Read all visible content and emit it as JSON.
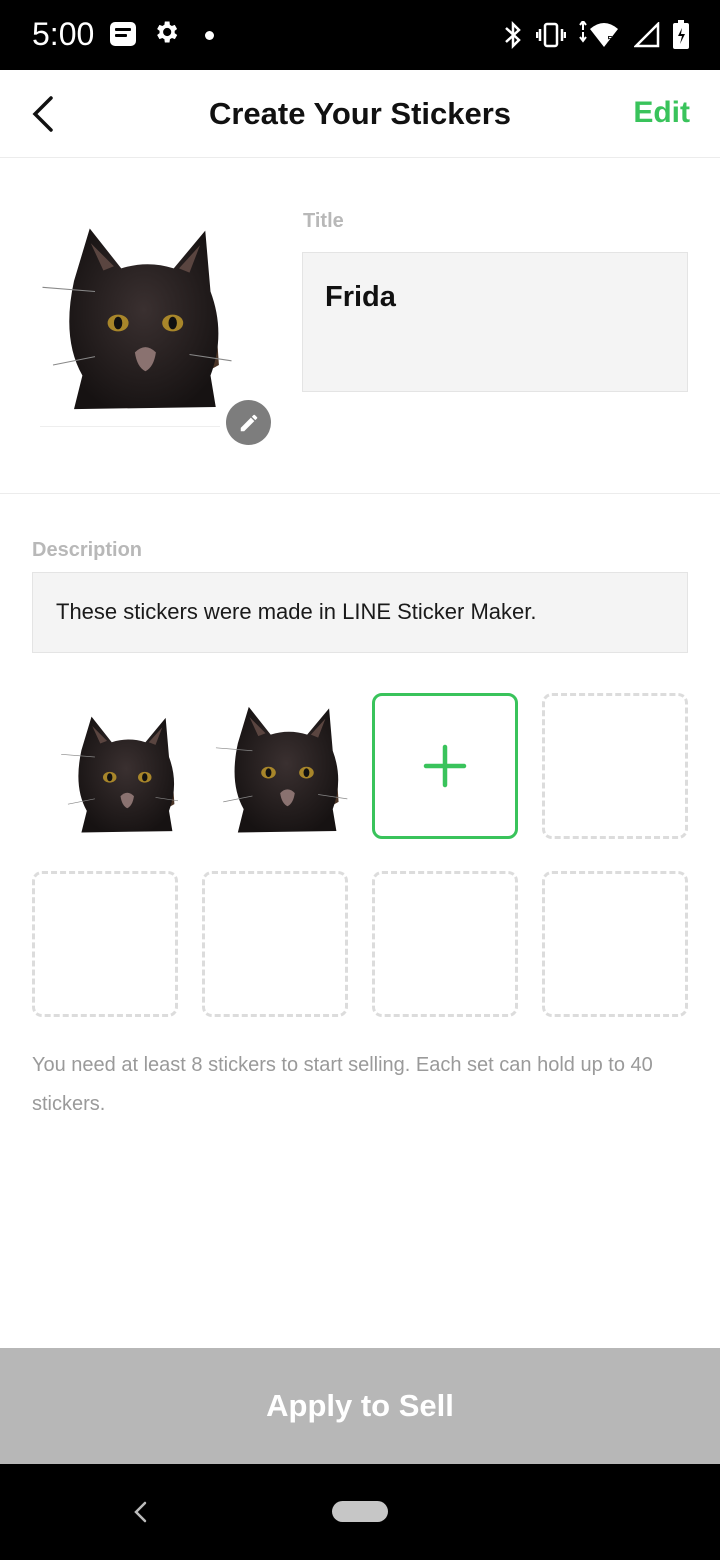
{
  "status_bar": {
    "time": "5:00",
    "icons_left": [
      "message-icon",
      "gear-icon",
      "dot-icon"
    ],
    "icons_right": [
      "bluetooth-icon",
      "vibrate-icon",
      "wifi-icon",
      "signal-icon",
      "battery-icon"
    ]
  },
  "app_bar": {
    "title": "Create Your Stickers",
    "edit_label": "Edit",
    "back_icon": "chevron-left-icon"
  },
  "sticker_set": {
    "main_image": "black-cat-sticker",
    "title_label": "Title",
    "title_value": "Frida",
    "description_label": "Description",
    "description_value": "These stickers were made in LINE Sticker Maker."
  },
  "stickers": {
    "slots": [
      {
        "type": "filled",
        "image": "black-cat-sticker"
      },
      {
        "type": "filled",
        "image": "black-cat-sticker"
      },
      {
        "type": "add",
        "icon": "plus-icon"
      },
      {
        "type": "empty"
      },
      {
        "type": "empty"
      },
      {
        "type": "empty"
      },
      {
        "type": "empty"
      },
      {
        "type": "empty"
      }
    ],
    "info": "You need at least 8 stickers to start selling. Each set can hold up to 40 stickers."
  },
  "apply_button": {
    "label": "Apply to Sell"
  },
  "colors": {
    "accent": "#39c35b",
    "button_disabled": "#b7b7b7",
    "field_bg": "#f4f4f4",
    "label_gray": "#b8b8b8"
  }
}
